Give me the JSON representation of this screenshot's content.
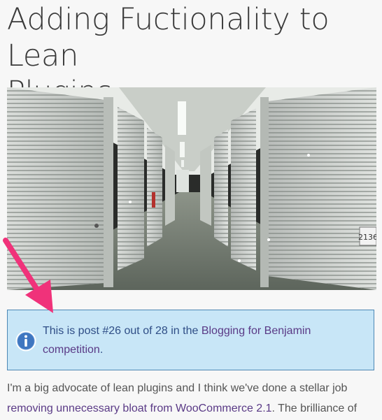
{
  "post": {
    "title_line1": "Adding Fuctionality to Lean",
    "title_line2": "Plugins"
  },
  "notice": {
    "text_before": "This is post #26 out of 28 in the ",
    "link": "Blogging for Benjamin",
    "text_middle": "",
    "link_line2": "competition",
    "text_after": "."
  },
  "intro": {
    "line1": "I'm a big advocate of lean plugins and I think we've done a stellar job",
    "link": "removing unnecessary bloat from WooCommerce 2.1",
    "line2_after": ". The brilliance of"
  },
  "image": {
    "unit_number": "2136",
    "alt": "storage units hallway"
  },
  "colors": {
    "notice_bg": "#c8e6f7",
    "notice_border": "#4d87b4",
    "link": "#5a3a86",
    "annotation_arrow": "#f0327a"
  },
  "icons": {
    "notice_icon": "info-icon"
  }
}
